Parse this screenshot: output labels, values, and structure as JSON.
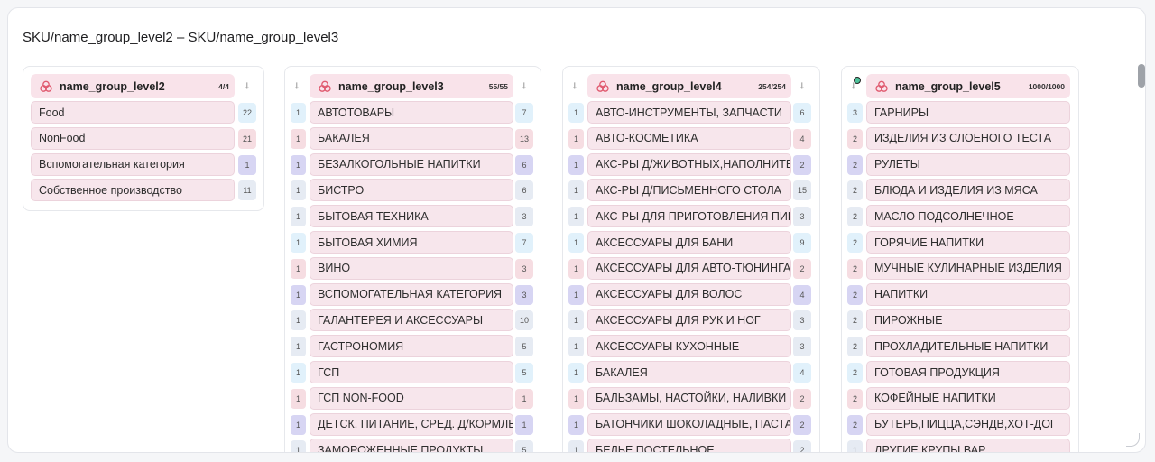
{
  "page_title": "SKU/name_group_level2 – SKU/name_group_level3",
  "colors": {
    "accent_pink": "#f7e6ec",
    "icon_red": "#e05a6f",
    "filter_dot": "#4ec29a"
  },
  "panels": [
    {
      "title": "name_group_level2",
      "count": "4/4",
      "icon": "cluster-icon",
      "sort_icon": "arrow-down-icon",
      "items": [
        {
          "label": "Food",
          "count": "22",
          "color": "c1"
        },
        {
          "label": "NonFood",
          "count": "21",
          "color": "c2"
        },
        {
          "label": "Вспомогательная категория",
          "count": "1",
          "color": "c3"
        },
        {
          "label": "Собственное производство",
          "count": "11",
          "color": "c4"
        }
      ]
    },
    {
      "title": "name_group_level3",
      "count": "55/55",
      "icon": "cluster-icon",
      "sort_icon": "arrow-down-icon",
      "items": [
        {
          "level": "1",
          "label": "АВТОТОВАРЫ",
          "count": "7",
          "color": "c1"
        },
        {
          "level": "1",
          "label": "БАКАЛЕЯ",
          "count": "13",
          "color": "c2"
        },
        {
          "level": "1",
          "label": "БЕЗАЛКОГОЛЬНЫЕ НАПИТКИ",
          "count": "6",
          "color": "c3"
        },
        {
          "level": "1",
          "label": "БИСТРО",
          "count": "6",
          "color": "c4"
        },
        {
          "level": "1",
          "label": "БЫТОВАЯ ТЕХНИКА",
          "count": "3",
          "color": "c4"
        },
        {
          "level": "1",
          "label": "БЫТОВАЯ ХИМИЯ",
          "count": "7",
          "color": "c1"
        },
        {
          "level": "1",
          "label": "ВИНО",
          "count": "3",
          "color": "c2"
        },
        {
          "level": "1",
          "label": "ВСПОМОГАТЕЛЬНАЯ КАТЕГОРИЯ",
          "count": "3",
          "color": "c3"
        },
        {
          "level": "1",
          "label": "ГАЛАНТЕРЕЯ И АКСЕССУАРЫ",
          "count": "10",
          "color": "c4"
        },
        {
          "level": "1",
          "label": "ГАСТРОНОМИЯ",
          "count": "5",
          "color": "c4"
        },
        {
          "level": "1",
          "label": "ГСП",
          "count": "5",
          "color": "c1"
        },
        {
          "level": "1",
          "label": "ГСП NON-FOOD",
          "count": "1",
          "color": "c2"
        },
        {
          "level": "1",
          "label": "ДЕТСК. ПИТАНИЕ, СРЕД. Д/КОРМЛЕНИЯ",
          "count": "1",
          "color": "c3"
        },
        {
          "level": "1",
          "label": "ЗАМОРОЖЕННЫЕ ПРОДУКТЫ",
          "count": "5",
          "color": "c4"
        }
      ]
    },
    {
      "title": "name_group_level4",
      "count": "254/254",
      "icon": "cluster-icon",
      "sort_icon": "arrow-down-icon",
      "items": [
        {
          "level": "1",
          "label": "АВТО-ИНСТРУМЕНТЫ, ЗАПЧАСТИ",
          "count": "6",
          "color": "c1"
        },
        {
          "level": "1",
          "label": "АВТО-КОСМЕТИКА",
          "count": "4",
          "color": "c2"
        },
        {
          "level": "1",
          "label": "АКС-РЫ Д/ЖИВОТНЫХ,НАПОЛНИТЕЛИ",
          "count": "2",
          "color": "c3"
        },
        {
          "level": "1",
          "label": "АКС-РЫ Д/ПИСЬМЕННОГО СТОЛА",
          "count": "15",
          "color": "c4"
        },
        {
          "level": "1",
          "label": "АКС-РЫ ДЛЯ ПРИГОТОВЛЕНИЯ ПИЩИ",
          "count": "3",
          "color": "c4"
        },
        {
          "level": "1",
          "label": "АКСЕССУАРЫ ДЛЯ БАНИ",
          "count": "9",
          "color": "c1"
        },
        {
          "level": "1",
          "label": "АКСЕССУАРЫ ДЛЯ АВТО-ТЮНИНГА",
          "count": "2",
          "color": "c2"
        },
        {
          "level": "1",
          "label": "АКСЕССУАРЫ ДЛЯ ВОЛОС",
          "count": "4",
          "color": "c3"
        },
        {
          "level": "1",
          "label": "АКСЕССУАРЫ ДЛЯ РУК И НОГ",
          "count": "3",
          "color": "c4"
        },
        {
          "level": "1",
          "label": "АКСЕССУАРЫ КУХОННЫЕ",
          "count": "3",
          "color": "c4"
        },
        {
          "level": "1",
          "label": "БАКАЛЕЯ",
          "count": "4",
          "color": "c1"
        },
        {
          "level": "1",
          "label": "БАЛЬЗАМЫ, НАСТОЙКИ, НАЛИВКИ",
          "count": "2",
          "color": "c2"
        },
        {
          "level": "1",
          "label": "БАТОНЧИКИ ШОКОЛАДНЫЕ, ПАСТА",
          "count": "2",
          "color": "c3"
        },
        {
          "level": "1",
          "label": "БЕЛЬЕ ПОСТЕЛЬНОЕ",
          "count": "2",
          "color": "c4"
        }
      ]
    },
    {
      "title": "name_group_level5",
      "count": "1000/1000",
      "icon": "cluster-icon",
      "sort_icon": "arrow-down-filter-icon",
      "items": [
        {
          "level": "3",
          "label": "ГАРНИРЫ",
          "color": "c1"
        },
        {
          "level": "2",
          "label": "ИЗДЕЛИЯ ИЗ СЛОЕНОГО ТЕСТА",
          "color": "c2"
        },
        {
          "level": "2",
          "label": "РУЛЕТЫ",
          "color": "c3"
        },
        {
          "level": "2",
          "label": "БЛЮДА И ИЗДЕЛИЯ ИЗ МЯСА",
          "color": "c4"
        },
        {
          "level": "2",
          "label": "МАСЛО ПОДСОЛНЕЧНОЕ",
          "color": "c4"
        },
        {
          "level": "2",
          "label": "ГОРЯЧИЕ НАПИТКИ",
          "color": "c1"
        },
        {
          "level": "2",
          "label": "МУЧНЫЕ КУЛИНАРНЫЕ ИЗДЕЛИЯ",
          "color": "c2"
        },
        {
          "level": "2",
          "label": "НАПИТКИ",
          "color": "c3"
        },
        {
          "level": "2",
          "label": "ПИРОЖНЫЕ",
          "color": "c4"
        },
        {
          "level": "2",
          "label": "ПРОХЛАДИТЕЛЬНЫЕ НАПИТКИ",
          "color": "c4"
        },
        {
          "level": "2",
          "label": "ГОТОВАЯ ПРОДУКЦИЯ",
          "color": "c1"
        },
        {
          "level": "2",
          "label": "КОФЕЙНЫЕ НАПИТКИ",
          "color": "c2"
        },
        {
          "level": "2",
          "label": "БУТЕРБ,ПИЦЦА,СЭНДВ,ХОТ-ДОГ",
          "color": "c3"
        },
        {
          "level": "1",
          "label": "ДРУГИЕ КРУПЫ ВАР",
          "color": "c4"
        }
      ]
    }
  ]
}
